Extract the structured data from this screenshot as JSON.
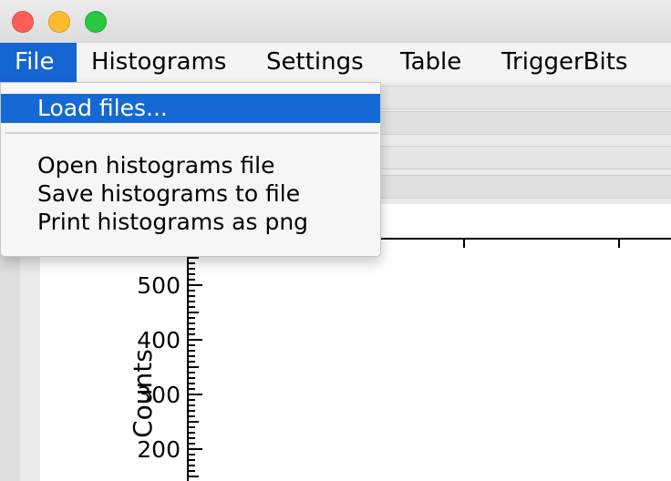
{
  "window": {
    "controls": [
      "close-button",
      "minimize-button",
      "maximize-button"
    ]
  },
  "menubar": {
    "items": [
      {
        "label": "File",
        "active": true
      },
      {
        "label": "Histograms"
      },
      {
        "label": "Settings"
      },
      {
        "label": "Table"
      },
      {
        "label": "TriggerBits"
      }
    ]
  },
  "file_menu": {
    "items": [
      {
        "label": "Load files...",
        "highlighted": true
      },
      {
        "label": "Open histograms file"
      },
      {
        "label": "Save histograms to file"
      },
      {
        "label": "Print histograms as png"
      }
    ]
  },
  "colors": {
    "accent": "#1464d2",
    "close": "#fc5f57",
    "minimize": "#fdbc2e",
    "maximize": "#28c840"
  },
  "chart_data": {
    "type": "histogram",
    "ylabel": "Counts",
    "y_ticks": [
      500,
      400,
      300,
      200
    ]
  }
}
